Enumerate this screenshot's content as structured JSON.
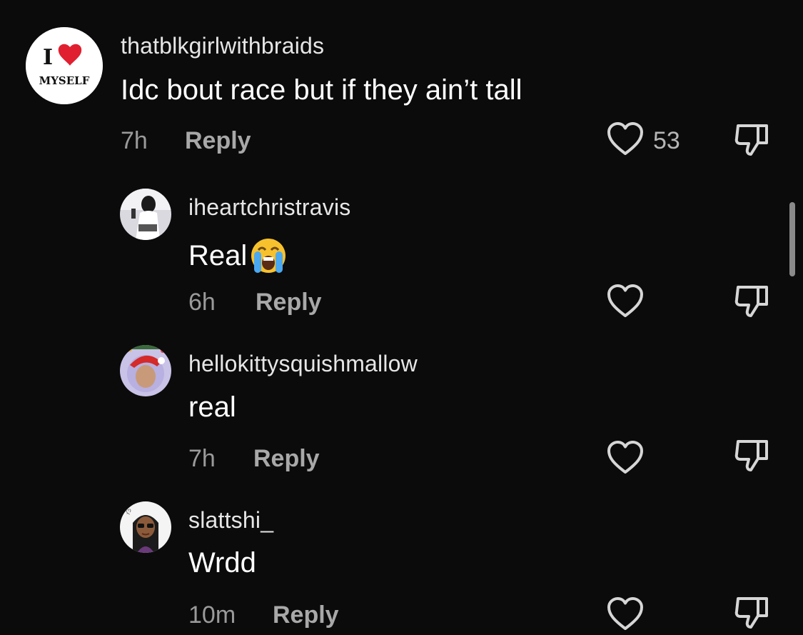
{
  "comments": [
    {
      "username": "thatblkgirlwithbraids",
      "text": "Idc bout race but if they ain’t tall",
      "time": "7h",
      "reply_label": "Reply",
      "like_count": "53",
      "avatar": {
        "line1": "I",
        "line2": "MYSELF"
      }
    },
    {
      "username": "iheartchristravis",
      "text": "Real",
      "time": "6h",
      "reply_label": "Reply",
      "like_count": "",
      "emoji": "loudly-crying-face-icon"
    },
    {
      "username": "hellokittysquishmallow",
      "text": "real",
      "time": "7h",
      "reply_label": "Reply",
      "like_count": ""
    },
    {
      "username": "slattshi_",
      "text": "Wrdd",
      "time": "10m",
      "reply_label": "Reply",
      "like_count": ""
    }
  ],
  "icons": {
    "like": "heart-outline-icon",
    "dislike": "thumbs-down-outline-icon"
  },
  "colors": {
    "background": "#0b0b0b",
    "heart_red": "#e02030",
    "muted_text": "#9a9a9a"
  }
}
